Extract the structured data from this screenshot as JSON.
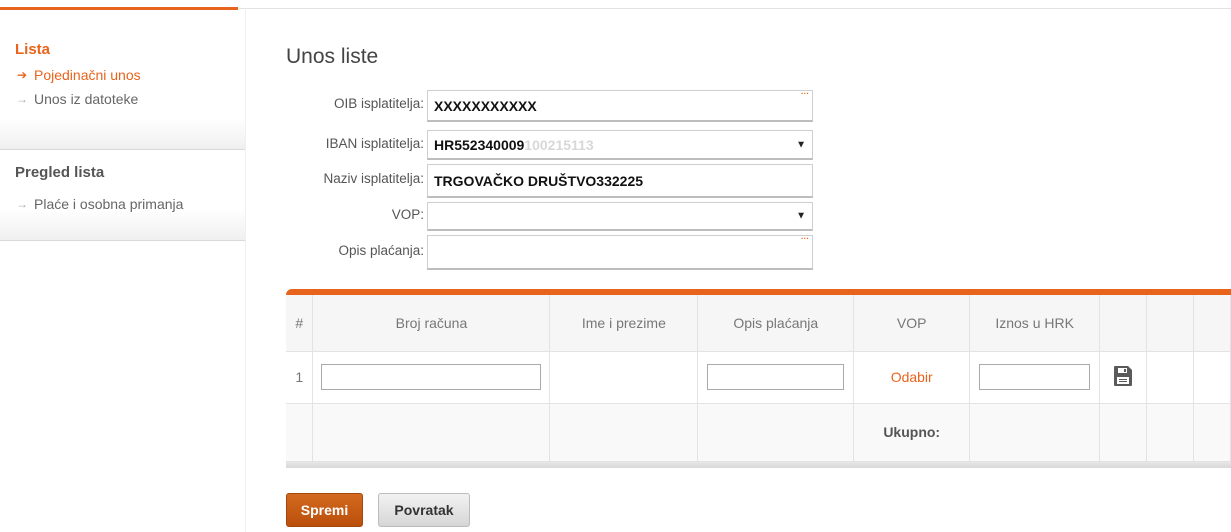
{
  "sidebar": {
    "sections": [
      {
        "heading": "Lista",
        "heading_color": "#e8641c",
        "items": [
          {
            "label": "Pojedinačni unos",
            "active": true
          },
          {
            "label": "Unos iz datoteke",
            "active": false
          }
        ]
      },
      {
        "heading": "Pregled lista",
        "heading_color": "#555555",
        "items": [
          {
            "label": "Plaće i osobna primanja",
            "active": false
          }
        ]
      }
    ]
  },
  "page": {
    "title": "Unos liste"
  },
  "form": {
    "oib": {
      "label": "OIB isplatitelja:",
      "value": "XXXXXXXXXXX"
    },
    "iban": {
      "label": "IBAN isplatitelja:",
      "value": "HR552340009",
      "value_faded": "100215113"
    },
    "naziv": {
      "label": "Naziv isplatitelja:",
      "value": "TRGOVAČKO DRUŠTVO332225"
    },
    "vop": {
      "label": "VOP:",
      "value": ""
    },
    "opis": {
      "label": "Opis plaćanja:",
      "value": ""
    }
  },
  "table": {
    "headers": [
      "#",
      "Broj računa",
      "Ime i prezime",
      "Opis plaćanja",
      "VOP",
      "Iznos u HRK",
      "",
      "",
      ""
    ],
    "rows": [
      {
        "num": "1",
        "broj_racuna": "",
        "ime_prezime": "",
        "opis": "",
        "vop_link": "Odabir",
        "iznos": ""
      }
    ],
    "sum_label": "Ukupno:"
  },
  "buttons": {
    "save": "Spremi",
    "back": "Povratak"
  },
  "colors": {
    "accent": "#e8641c"
  },
  "icons": {
    "active_arrow": "arrow-right-icon",
    "inactive_arrow": "arrow-right-icon",
    "save_row": "floppy-disk-icon",
    "dropdown": "caret-down-icon"
  }
}
